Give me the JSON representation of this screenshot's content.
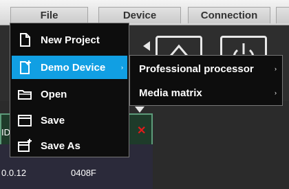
{
  "menubar": {
    "tabs": [
      {
        "label": "File"
      },
      {
        "label": "Device"
      },
      {
        "label": "Connection"
      }
    ]
  },
  "file_menu": {
    "items": [
      {
        "label": "New Project",
        "icon": "new-project-icon"
      },
      {
        "label": "Demo Device",
        "icon": "demo-device-icon",
        "highlighted": true,
        "has_submenu": true
      },
      {
        "label": "Open",
        "icon": "folder-icon"
      },
      {
        "label": "Save",
        "icon": "save-icon"
      },
      {
        "label": "Save As",
        "icon": "save-as-icon"
      }
    ]
  },
  "demo_submenu": {
    "items": [
      {
        "label": "Professional processor"
      },
      {
        "label": "Media matrix"
      }
    ]
  },
  "device_tile": {
    "ip": "0.0.12",
    "id": "0408F",
    "label_fragment": "ID"
  },
  "colors": {
    "menu_bg": "#0d0d0d",
    "highlight": "#119fe3",
    "close_red": "#e21b1b"
  },
  "submenu_arrow_glyph": "›",
  "close_glyph": "✕"
}
